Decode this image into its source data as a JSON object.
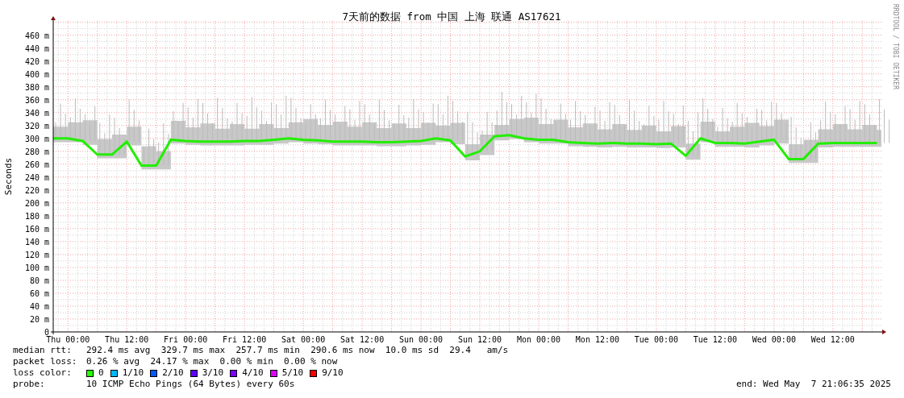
{
  "chart": {
    "credit": "RRDTOOL / TOBI OETIKER",
    "chart_data": {
      "type": "line",
      "title": "7天前的数据 from 中国 上海 联通 AS17621",
      "ylabel": "Seconds",
      "categories": [
        null,
        "Thu 00:00",
        null,
        null,
        null,
        "Thu 12:00",
        null,
        null,
        null,
        "Fri 00:00",
        null,
        null,
        null,
        "Fri 12:00",
        null,
        null,
        null,
        "Sat 00:00",
        null,
        null,
        null,
        "Sat 12:00",
        null,
        null,
        null,
        "Sun 00:00",
        null,
        null,
        null,
        "Sun 12:00",
        null,
        null,
        null,
        "Mon 00:00",
        null,
        null,
        null,
        "Mon 12:00",
        null,
        null,
        null,
        "Tue 00:00",
        null,
        null,
        null,
        "Tue 12:00",
        null,
        null,
        null,
        "Wed 00:00",
        null,
        null,
        null,
        "Wed 12:00",
        null,
        null,
        null
      ],
      "series": [
        {
          "name": "median rtt:",
          "color": "#22ee00",
          "values": [
            300,
            300,
            296,
            275,
            275,
            295,
            258,
            258,
            298,
            296,
            295,
            295,
            295,
            296,
            296,
            298,
            300,
            298,
            297,
            295,
            295,
            295,
            294,
            294,
            295,
            296,
            300,
            297,
            272,
            280,
            303,
            305,
            300,
            298,
            298,
            294,
            293,
            292,
            293,
            292,
            292,
            291,
            292,
            273,
            300,
            293,
            293,
            292,
            295,
            298,
            268,
            268,
            292,
            293,
            293,
            293,
            293
          ]
        }
      ],
      "ylim": [
        0,
        482
      ],
      "grid": true,
      "yticks": [
        {
          "value": 0,
          "label": "0"
        },
        {
          "value": 20,
          "label": "20 m"
        },
        {
          "value": 40,
          "label": "40 m"
        },
        {
          "value": 60,
          "label": "60 m"
        },
        {
          "value": 80,
          "label": "80 m"
        },
        {
          "value": 100,
          "label": "100 m"
        },
        {
          "value": 120,
          "label": "120 m"
        },
        {
          "value": 140,
          "label": "140 m"
        },
        {
          "value": 160,
          "label": "160 m"
        },
        {
          "value": 180,
          "label": "180 m"
        },
        {
          "value": 200,
          "label": "200 m"
        },
        {
          "value": 220,
          "label": "220 m"
        },
        {
          "value": 240,
          "label": "240 m"
        },
        {
          "value": 260,
          "label": "260 m"
        },
        {
          "value": 280,
          "label": "280 m"
        },
        {
          "value": 300,
          "label": "300 m"
        },
        {
          "value": 320,
          "label": "320 m"
        },
        {
          "value": 340,
          "label": "340 m"
        },
        {
          "value": 360,
          "label": "360 m"
        },
        {
          "value": 380,
          "label": "380 m"
        },
        {
          "value": 400,
          "label": "400 m"
        },
        {
          "value": 420,
          "label": "420 m"
        },
        {
          "value": 440,
          "label": "440 m"
        },
        {
          "value": 460,
          "label": "460 m"
        }
      ]
    }
  },
  "stats": [
    {
      "text": "292.4 ms avg  329.7 ms max  257.7 ms min  290.6 ms now  10.0 ms sd  29.4   am/s"
    },
    {
      "label": "packet loss:",
      "text": "0.26 % avg  24.17 % max  0.00 % min  0.00 % now"
    }
  ],
  "loss_colors": {
    "label": "loss color:",
    "items": [
      {
        "label": "0",
        "color": "#26ff00"
      },
      {
        "label": "1/10",
        "color": "#00b8ff"
      },
      {
        "label": "2/10",
        "color": "#0059ff"
      },
      {
        "label": "3/10",
        "color": "#5e00ff"
      },
      {
        "label": "4/10",
        "color": "#7e00ff"
      },
      {
        "label": "5/10",
        "color": "#dd00ff"
      },
      {
        "label": "9/10",
        "color": "#ff0000"
      }
    ]
  },
  "probe": {
    "label": "probe:",
    "text": "10 ICMP Echo Pings (64 Bytes) every 60s",
    "end": "end: Wed May  7 21:06:35 2025"
  }
}
